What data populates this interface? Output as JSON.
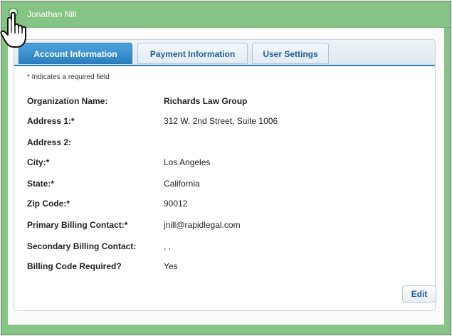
{
  "header": {
    "user_name": "Jonathan Nill"
  },
  "tabs": [
    {
      "label": "Account Information"
    },
    {
      "label": "Payment Information"
    },
    {
      "label": "User Settings"
    }
  ],
  "note": "* Indicates a required field",
  "fields": [
    {
      "label": "Organization Name:",
      "value": "Richards Law Group"
    },
    {
      "label": "Address 1:*",
      "value": "312 W. 2nd Street, Suite 1006"
    },
    {
      "label": "Address 2:",
      "value": ""
    },
    {
      "label": "City:*",
      "value": "Los Angeles"
    },
    {
      "label": "State:*",
      "value": "California"
    },
    {
      "label": "Zip Code:*",
      "value": "90012"
    },
    {
      "label": "Primary Billing Contact:*",
      "value": "jnill@rapidlegal.com"
    },
    {
      "label": "Secondary Billing Contact:",
      "value": ", ,"
    },
    {
      "label": "Billing Code Required?",
      "value": "Yes"
    }
  ],
  "edit_label": "Edit"
}
